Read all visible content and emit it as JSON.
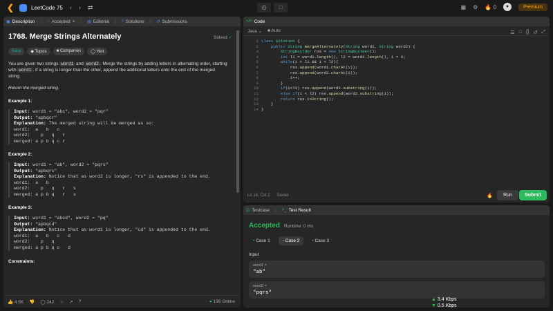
{
  "topbar": {
    "title": "LeetCode 75",
    "streak": "0",
    "premium": "Premium"
  },
  "left": {
    "tabs": [
      {
        "label": "Description"
      },
      {
        "label": "Accepted"
      },
      {
        "label": "Editorial"
      },
      {
        "label": "Solutions"
      },
      {
        "label": "Submissions"
      }
    ],
    "title": "1768. Merge Strings Alternately",
    "solved": "Solved",
    "chips": {
      "easy": "Easy",
      "topics": "Topics",
      "companies": "Companies",
      "hint": "Hint"
    },
    "desc": {
      "p1a": "You are given two strings ",
      "w1": "word1",
      "p1b": " and ",
      "w2": "word2",
      "p1c": ". Merge the strings by adding letters in alternating order, starting with ",
      "w1b": "word1",
      "p1d": ". If a string is longer than the other, append the additional letters onto the end of the merged string.",
      "p2": "Return the merged string."
    },
    "examples": [
      {
        "h": "Example 1:",
        "input_label": "Input:",
        "input": " word1 = \"abc\", word2 = \"pqr\"",
        "output_label": "Output:",
        "output": " \"apbqcr\"",
        "expl_label": "Explanation:",
        "expl": " The merged string will be merged as so:",
        "r1": "word1:  a   b   c",
        "r2": "word2:    p   q   r",
        "r3": "merged: a p b q c r"
      },
      {
        "h": "Example 2:",
        "input_label": "Input:",
        "input": " word1 = \"ab\", word2 = \"pqrs\"",
        "output_label": "Output:",
        "output": " \"apbqrs\"",
        "expl_label": "Explanation:",
        "expl": " Notice that as word2 is longer, \"rs\" is appended to the end.",
        "r1": "word1:  a   b",
        "r2": "word2:    p   q   r   s",
        "r3": "merged: a p b q   r   s"
      },
      {
        "h": "Example 3:",
        "input_label": "Input:",
        "input": " word1 = \"abcd\", word2 = \"pq\"",
        "output_label": "Output:",
        "output": " \"apbqcd\"",
        "expl_label": "Explanation:",
        "expl": " Notice that as word1 is longer, \"cd\" is appended to the end.",
        "r1": "word1:  a   b   c   d",
        "r2": "word2:    p   q",
        "r3": "merged: a p b q c   d"
      }
    ],
    "constraints": "Constraints:",
    "footer": {
      "likes": "4.5K",
      "comments": "242",
      "online": "196 Online"
    }
  },
  "editor": {
    "tab": "Code",
    "lang": "Java",
    "auto": "Auto",
    "lines": [
      "1",
      "2",
      "3",
      "4",
      "5",
      "6",
      "7",
      "8",
      "9",
      "10",
      "11",
      "12",
      "13",
      "14"
    ],
    "status": {
      "pos": "Ln 14, Col 2",
      "saved": "Saved"
    },
    "run": "Run",
    "submit": "Submit"
  },
  "result": {
    "tabs": {
      "testcase": "Testcase",
      "result": "Test Result"
    },
    "accepted": "Accepted",
    "runtime": "Runtime: 0 ms",
    "cases": [
      "Case 1",
      "Case 2",
      "Case 3"
    ],
    "input_label": "Input",
    "inputs": [
      {
        "k": "word1 =",
        "v": "\"ab\""
      },
      {
        "k": "word2 =",
        "v": "\"pqrs\""
      }
    ],
    "net": {
      "up": "3.4 Kbps",
      "down": "0.5 Kbps"
    }
  }
}
